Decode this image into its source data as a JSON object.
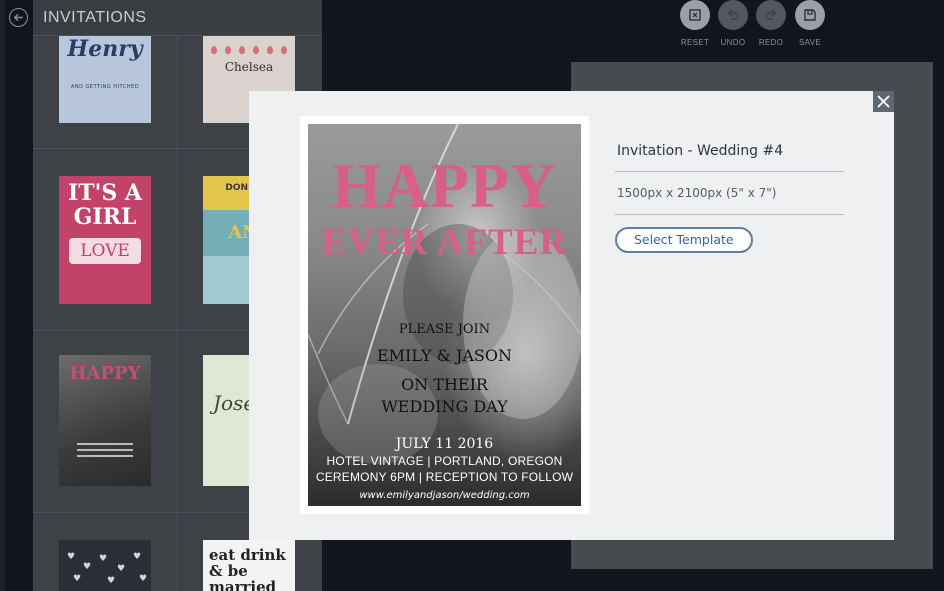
{
  "sidebar": {
    "title": "INVITATIONS",
    "thumbnails": {
      "henry": "Henry",
      "henry_sub": "AND GETTING HITCHED",
      "chelsea": "Chelsea",
      "girl_line1": "IT'S A",
      "girl_line2": "GIRL",
      "girl_badge": "LOVE",
      "anton_band1": "DON'T BL",
      "anton_band2": "ANT",
      "happy": "HAPPY",
      "josef": "Jose",
      "married": "eat drink & be married"
    }
  },
  "toolbar": {
    "reset": "RESET",
    "undo": "UNDO",
    "redo": "REDO",
    "save": "SAVE"
  },
  "modal": {
    "title": "Invitation - Wedding #4",
    "size": "1500px x 2100px (5\" x 7\")",
    "select_label": "Select Template",
    "preview": {
      "happy": "HAPPY",
      "ever_after": "EVER AFTER",
      "please_join": "PLEASE JOIN",
      "names": "EMILY & JASON",
      "on_their": "ON THEIR",
      "wedding_day": "WEDDING DAY",
      "date": "JULY 11 2016",
      "venue": "HOTEL VINTAGE | PORTLAND, OREGON",
      "schedule": "CEREMONY 6PM | RECEPTION TO FOLLOW",
      "url": "www.emilyandjason/wedding.com"
    }
  },
  "colors": {
    "accent_pink": "#d85f86",
    "button_blue": "#5c7fa3",
    "modal_bg": "#eff0f2",
    "page_bg": "#11151c"
  },
  "icons": {
    "back": "arrow-left-circle-icon",
    "reset": "reset-icon",
    "undo": "undo-icon",
    "redo": "redo-icon",
    "save": "save-icon",
    "close": "close-icon"
  }
}
